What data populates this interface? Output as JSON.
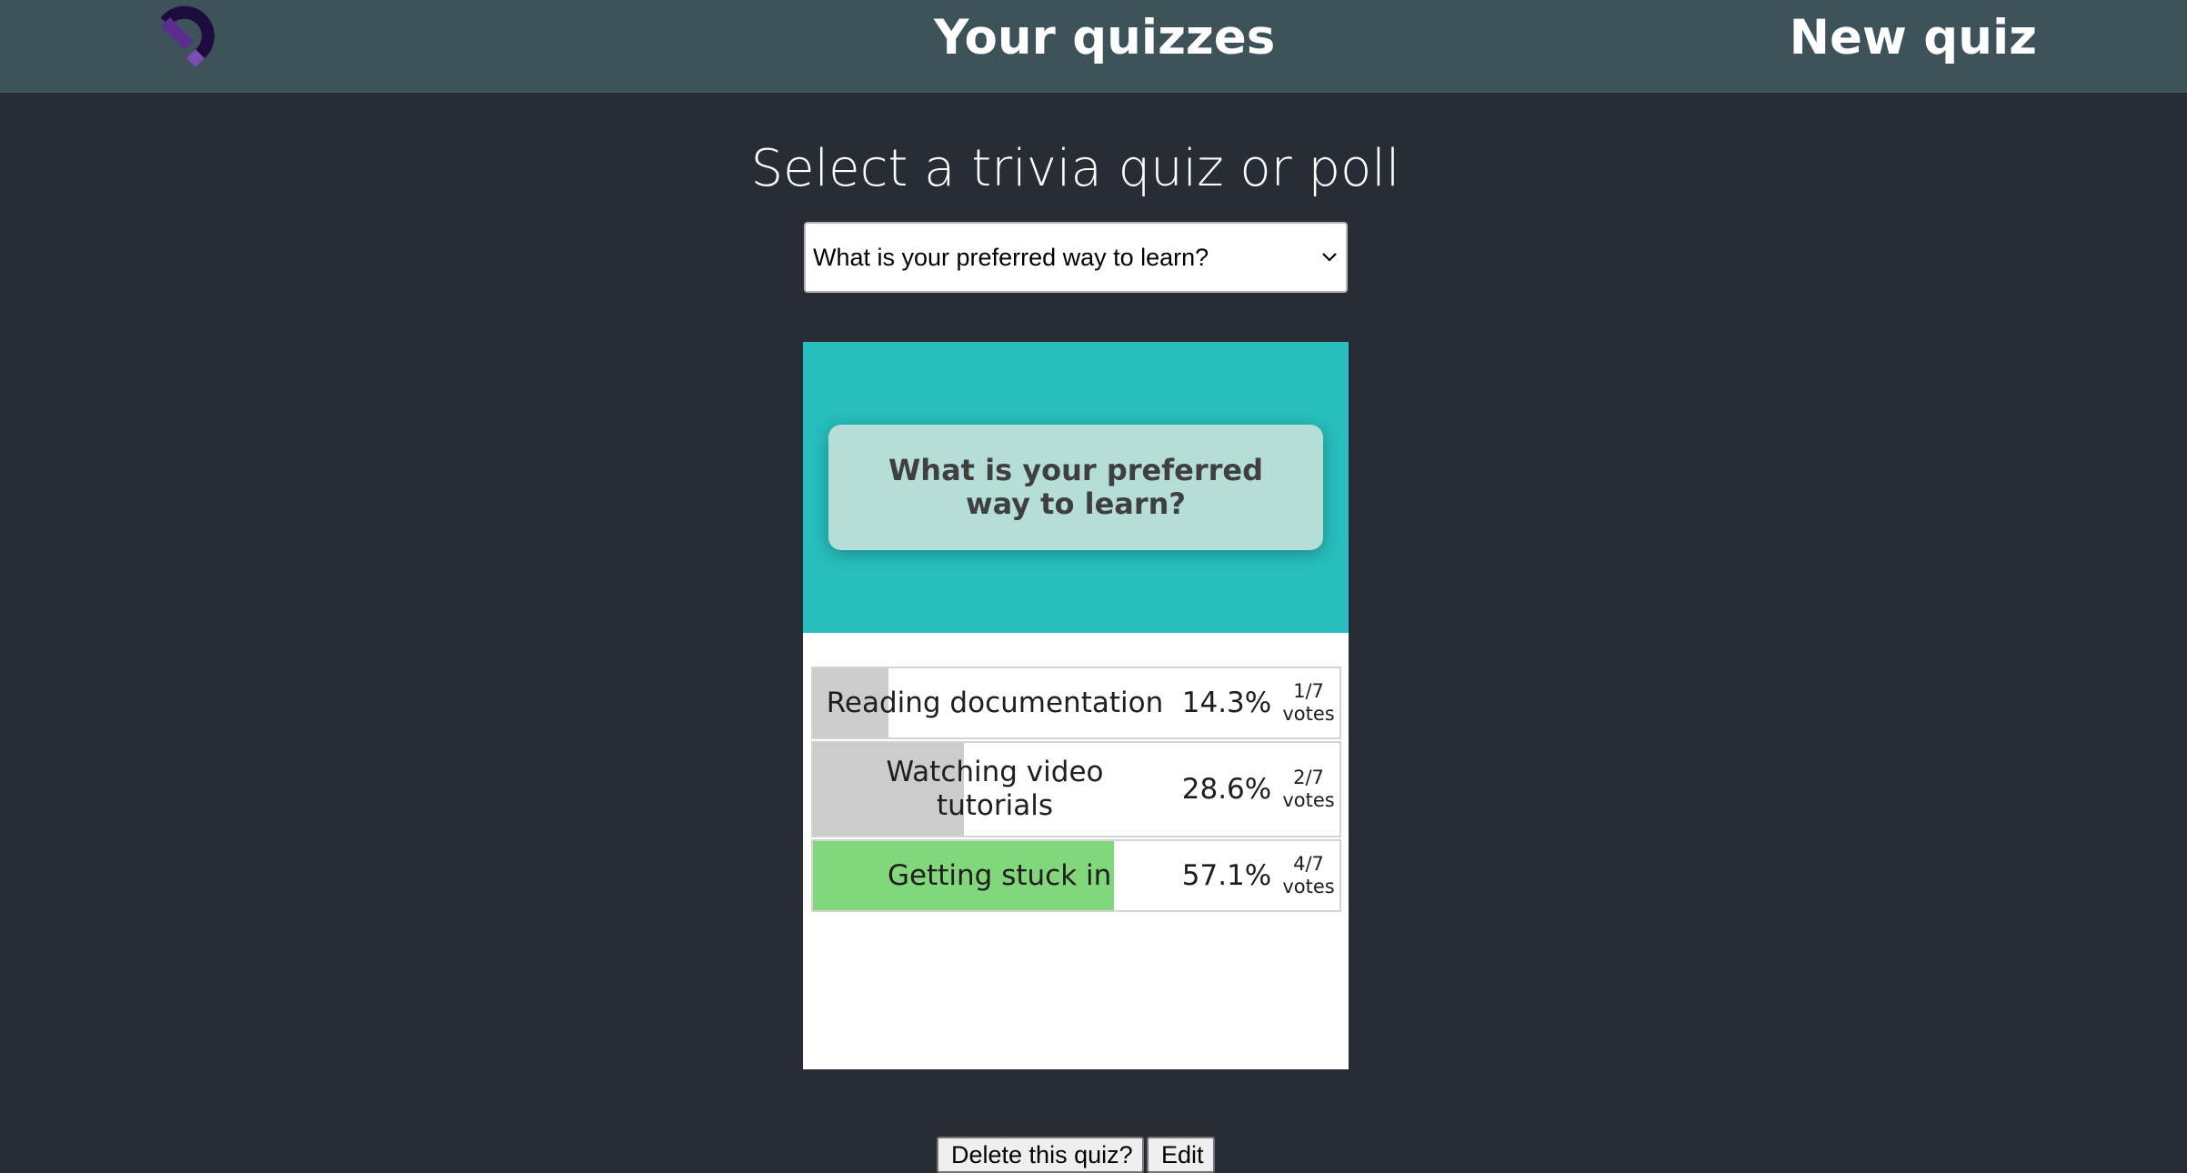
{
  "header": {
    "logo_icon": "horseshoe-magnet-logo-icon",
    "nav_your_quizzes": "Your quizzes",
    "nav_new_quiz": "New quiz"
  },
  "page": {
    "title": "Select a trivia quiz or poll"
  },
  "quiz_select": {
    "selected_value": "What is your preferred way to learn?",
    "icon": "chevron-down-icon"
  },
  "quiz": {
    "question": "What is your preferred way to learn?",
    "answers": [
      {
        "label": "Reading documentation",
        "percent": "14.3%",
        "fraction": 0.143,
        "votes_count": "1/7",
        "votes_label": "votes",
        "leader": false
      },
      {
        "label": "Watching video tutorials",
        "percent": "28.6%",
        "fraction": 0.286,
        "votes_count": "2/7",
        "votes_label": "votes",
        "leader": false
      },
      {
        "label": "Getting stuck in",
        "percent": "57.1%",
        "fraction": 0.571,
        "votes_count": "4/7",
        "votes_label": "votes",
        "leader": true
      }
    ]
  },
  "actions": {
    "delete_label": "Delete this quiz?",
    "edit_label": "Edit"
  },
  "colors": {
    "background": "#272c35",
    "header": "#3d5259",
    "card_accent": "#27bebd",
    "question_box": "#b6ded8",
    "leader_fill": "#82d67b",
    "other_fill": "#cccccc"
  }
}
